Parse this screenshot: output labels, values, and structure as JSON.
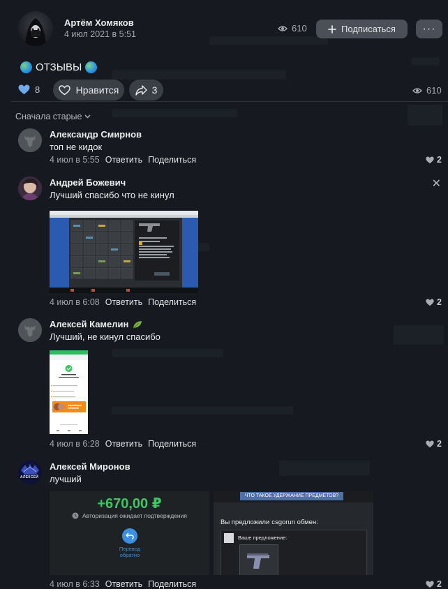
{
  "post": {
    "author": "Артём Хомяков",
    "date": "4 июл 2021 в 5:51",
    "views": "610",
    "subscribe_label": "Подписаться",
    "more_label": "···",
    "text": "ОТЗЫВЫ",
    "likes": "8",
    "like_label": "Нравится",
    "shares": "3",
    "views_bottom": "610"
  },
  "comments_sort": "Сначала старые",
  "comments": [
    {
      "author": "Александр Смирнов",
      "text": "топ не кидок",
      "date": "4 июл в 5:55",
      "reply": "Ответить",
      "share": "Поделиться",
      "likes": "2"
    },
    {
      "author": "Андрей Божевич",
      "text": "Лучший спасибо что не кинул",
      "date": "4 июл в 6:08",
      "reply": "Ответить",
      "share": "Поделиться",
      "likes": "2"
    },
    {
      "author": "Алексей Камелин",
      "text": "Лучший, не кинул спасибо",
      "date": "4 июл в 6:28",
      "reply": "Ответить",
      "share": "Поделиться",
      "likes": "2"
    },
    {
      "author": "Алексей Миронов",
      "text": "лучший",
      "date": "4 июл в 6:33",
      "reply": "Ответить",
      "share": "Поделиться",
      "likes": "2"
    }
  ],
  "attachments": {
    "mironov_amount": "+670,00 ₽",
    "mironov_status": "Авторизация ожидает подтверждения",
    "mironov_return": "Перевод обратно",
    "mironov_btn": "ЧТО ТАКОЕ УДЕРЖАНИЕ ПРЕДМЕТОВ?",
    "mironov_offer": "Вы предложили",
    "mironov_offer_user": "csgorun обмен:",
    "mironov_your_offer": "Ваше предложение:",
    "mironov_avatar_text": "АЛЕКСЕЙ"
  },
  "colors": {
    "background": "#161a20",
    "button": "#4b5058",
    "pill": "#3a3e45",
    "like_blue": "#71aaeb",
    "money_green": "#3cc763"
  }
}
